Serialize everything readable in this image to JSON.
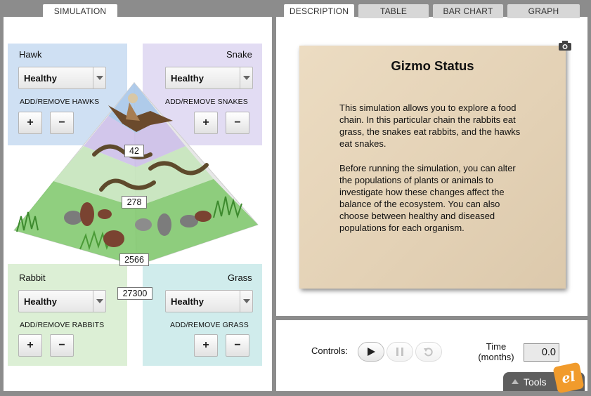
{
  "tabs": {
    "left": [
      "SIMULATION"
    ],
    "right": [
      "DESCRIPTION",
      "TABLE",
      "BAR CHART",
      "GRAPH"
    ]
  },
  "colors": {
    "hawk_panel": "#cfe0f3",
    "snake_panel": "#e2dcf3",
    "rabbit_panel": "#dcefd5",
    "grass_panel": "#d0ecec",
    "card": "#e6d5ba",
    "tools_bar": "#5e5e5e",
    "logo": "#f19b2c"
  },
  "hawk": {
    "name": "Hawk",
    "health": "Healthy",
    "add_label": "ADD/REMOVE HAWKS",
    "plus": "+",
    "minus": "−"
  },
  "snake": {
    "name": "Snake",
    "health": "Healthy",
    "add_label": "ADD/REMOVE SNAKES",
    "plus": "+",
    "minus": "−"
  },
  "rabbit": {
    "name": "Rabbit",
    "health": "Healthy",
    "add_label": "ADD/REMOVE RABBITS",
    "plus": "+",
    "minus": "−"
  },
  "grass": {
    "name": "Grass",
    "health": "Healthy",
    "add_label": "ADD/REMOVE GRASS",
    "plus": "+",
    "minus": "−"
  },
  "populations": {
    "hawks": "42",
    "snakes": "278",
    "rabbits": "2566",
    "grass": "27300"
  },
  "status": {
    "title": "Gizmo Status",
    "p1": "This simulation allows you to explore a food chain. In this particular chain the rabbits eat grass, the snakes eat rabbits, and the hawks eat snakes.",
    "p2": "Before running the simulation, you can alter the populations of plants or animals to investigate how these changes affect the balance of the ecosystem. You can also choose between healthy and diseased populations for each organism."
  },
  "controls": {
    "label": "Controls:",
    "time_label": "Time (months)",
    "time_value": "0.0",
    "tools_label": "Tools",
    "logo_text": "el"
  },
  "icons": [
    "camera-icon",
    "play-icon",
    "pause-icon",
    "reset-icon",
    "tools-arrow-icon"
  ]
}
